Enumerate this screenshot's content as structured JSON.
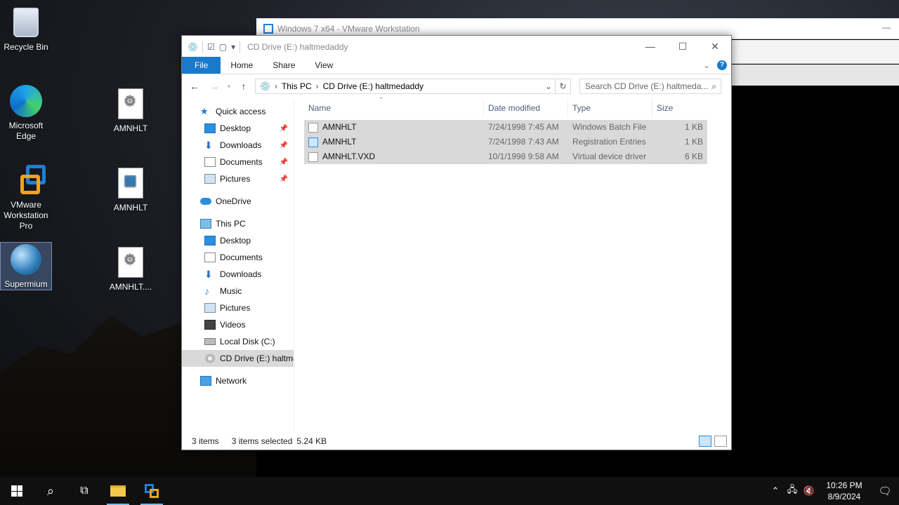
{
  "desktop": {
    "icons": [
      {
        "label": "Recycle Bin"
      },
      {
        "label": "Microsoft Edge"
      },
      {
        "label": "AMNHLT"
      },
      {
        "label": "VMware Workstation Pro"
      },
      {
        "label": "AMNHLT"
      },
      {
        "label": "Supermium"
      },
      {
        "label": "AMNHLT...."
      }
    ]
  },
  "vmware_window": {
    "title": "Windows 7 x64 - VMware Workstation"
  },
  "explorer": {
    "title": "CD Drive (E:) haltmedaddy",
    "ribbon_tabs": [
      "File",
      "Home",
      "Share",
      "View"
    ],
    "address": {
      "crumbs": [
        "This PC",
        "CD Drive (E:) haltmedaddy"
      ]
    },
    "search_placeholder": "Search CD Drive (E:) haltmeda...",
    "nav": {
      "quick_access": "Quick access",
      "quick_items": [
        "Desktop",
        "Downloads",
        "Documents",
        "Pictures"
      ],
      "onedrive": "OneDrive",
      "this_pc": "This PC",
      "pc_items": [
        "Desktop",
        "Documents",
        "Downloads",
        "Music",
        "Pictures",
        "Videos",
        "Local Disk (C:)",
        "CD Drive (E:) haltme"
      ],
      "network": "Network"
    },
    "columns": [
      "Name",
      "Date modified",
      "Type",
      "Size"
    ],
    "files": [
      {
        "name": "AMNHLT",
        "date": "7/24/1998 7:45 AM",
        "type": "Windows Batch File",
        "size": "1 KB"
      },
      {
        "name": "AMNHLT",
        "date": "7/24/1998 7:43 AM",
        "type": "Registration Entries",
        "size": "1 KB"
      },
      {
        "name": "AMNHLT.VXD",
        "date": "10/1/1998 9:58 AM",
        "type": "Virtual device driver",
        "size": "6 KB"
      }
    ],
    "status": {
      "count": "3 items",
      "selected": "3 items selected",
      "size": "5.24 KB"
    }
  },
  "taskbar": {
    "time": "10:26 PM",
    "date": "8/9/2024"
  }
}
